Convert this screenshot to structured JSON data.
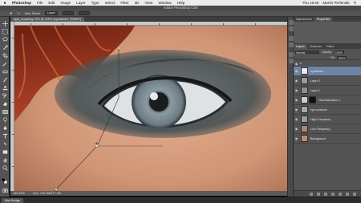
{
  "menubar": {
    "items": [
      "Photoshop",
      "File",
      "Edit",
      "Image",
      "Layer",
      "Type",
      "Select",
      "Filter",
      "3D",
      "View",
      "Window",
      "Help"
    ],
    "clock": "Thu 19:40",
    "user": "Martin Perhiniak"
  },
  "window": {
    "title": "Adobe Photoshop CS6"
  },
  "options": {
    "auto_select": "Auto-Select",
    "mode": "Layer"
  },
  "document": {
    "tab": "light_sculpting.CR2 @ 145% (eyelashes, RGB/8*)",
    "zoom": "145.45%",
    "doc_info": "Doc: 115.1M/277.9M"
  },
  "panels": {
    "top_tabs": [
      "Adjustments",
      "Properties"
    ],
    "layer_tabs": [
      "Layers",
      "Channels",
      "Paths"
    ],
    "blend_mode": "Normal",
    "opacity_label": "Opacity:",
    "opacity": "100%",
    "fill_label": "Fill:",
    "fill": "100%"
  },
  "layers": [
    {
      "name": "",
      "group": true
    },
    {
      "name": "eyelashes",
      "selected": true,
      "thumb": "#eaeaea",
      "mask": false
    },
    {
      "name": "Layer 2",
      "thumb": "#9a9a9a",
      "mask": false
    },
    {
      "name": "Layer 1",
      "thumb": "#8f8f8f",
      "mask": false
    },
    {
      "name": "Hue/Saturation 1",
      "thumb": "#cfcfcf",
      "mask": true
    },
    {
      "name": "eye contours",
      "thumb": "#a8a8a8",
      "mask": false
    },
    {
      "name": "High Frequency",
      "thumb": "#9c9c9c",
      "mask": false
    },
    {
      "name": "Low Frequency",
      "thumb": "#b5826a",
      "mask": false
    },
    {
      "name": "Background",
      "thumb": "#c08a6c",
      "mask": false
    }
  ],
  "bottom": {
    "tab": "Mini Bridge"
  }
}
